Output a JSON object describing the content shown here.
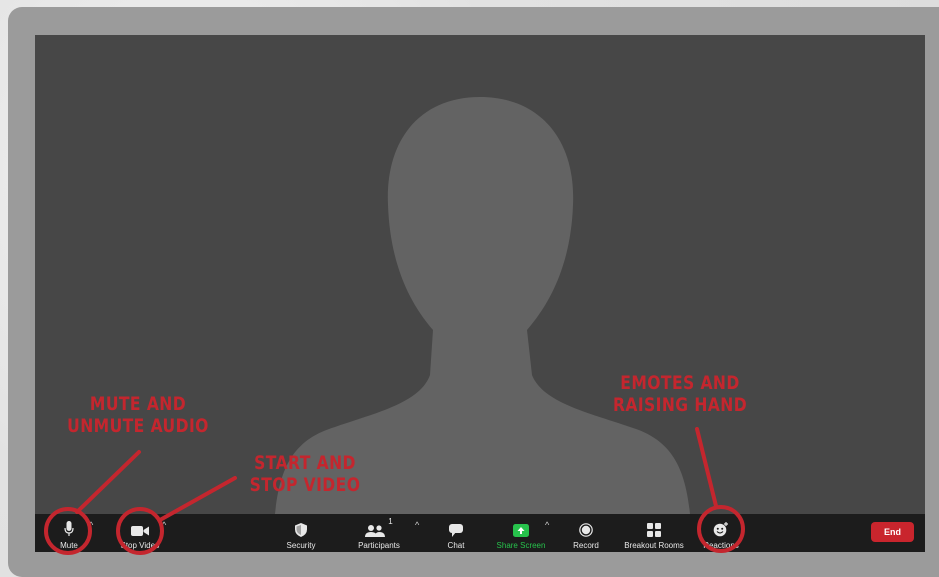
{
  "toolbar": {
    "mute_label": "Mute",
    "stop_video_label": "Stop Video",
    "security_label": "Security",
    "participants_label": "Participants",
    "participants_count": "1",
    "chat_label": "Chat",
    "share_screen_label": "Share Screen",
    "record_label": "Record",
    "breakout_rooms_label": "Breakout Rooms",
    "reactions_label": "Reactions",
    "end_label": "End"
  },
  "annotations": {
    "mute_line1": "MUTE AND",
    "mute_line2": "UNMUTE AUDIO",
    "video_line1": "START AND",
    "video_line2": "STOP VIDEO",
    "reactions_line1": "EMOTES AND",
    "reactions_line2": "RAISING HAND"
  },
  "colors": {
    "annotation_red": "#c4262e",
    "share_screen_green": "#27c24c",
    "end_button_red": "#c9252d",
    "toolbar_bg": "#1c1c1c",
    "video_bg": "#474747"
  },
  "icons": [
    "microphone-icon",
    "video-camera-icon",
    "shield-icon",
    "participants-icon",
    "chat-bubble-icon",
    "share-screen-icon",
    "record-icon",
    "grid-icon",
    "smiley-icon"
  ]
}
